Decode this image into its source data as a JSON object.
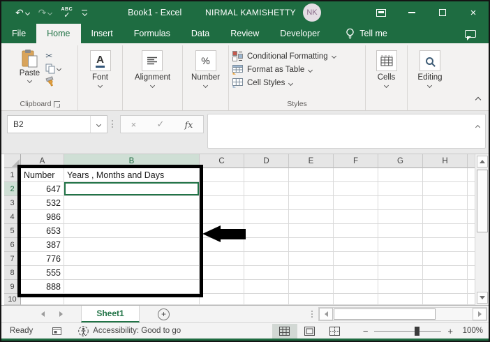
{
  "titlebar": {
    "title": "Book1 - Excel",
    "account_name": "NIRMAL KAMISHETTY",
    "avatar_initials": "NK"
  },
  "ribbon_tabs": [
    {
      "label": "File"
    },
    {
      "label": "Home"
    },
    {
      "label": "Insert"
    },
    {
      "label": "Formulas"
    },
    {
      "label": "Data"
    },
    {
      "label": "Review"
    },
    {
      "label": "Developer"
    }
  ],
  "tell_me_label": "Tell me",
  "ribbon": {
    "paste_label": "Paste",
    "clipboard_group_label": "Clipboard",
    "font_label": "Font",
    "alignment_label": "Alignment",
    "number_label": "Number",
    "conditional_formatting_label": "Conditional Formatting",
    "format_as_table_label": "Format as Table",
    "cell_styles_label": "Cell Styles",
    "styles_group_label": "Styles",
    "cells_label": "Cells",
    "editing_label": "Editing"
  },
  "formula_bar": {
    "name_box": "B2",
    "value": ""
  },
  "icons": {
    "undo_glyph": "↶",
    "redo_glyph": "↷",
    "spell_label": "ABC",
    "check_glyph": "✓",
    "cancel_glyph": "×",
    "close_glyph": "×",
    "scissors_glyph": "✂",
    "fx_label": "fx",
    "font_glyph": "A",
    "percent_glyph": "%",
    "new_sheet_glyph": "+"
  },
  "grid": {
    "columns": [
      "A",
      "B",
      "C",
      "D",
      "E",
      "F",
      "G",
      "H"
    ],
    "selected_cell": "B2",
    "rows": [
      {
        "num": "1",
        "a": "Number",
        "b": "Years , Months and Days"
      },
      {
        "num": "2",
        "a": "647",
        "b": ""
      },
      {
        "num": "3",
        "a": "532",
        "b": ""
      },
      {
        "num": "4",
        "a": "986",
        "b": ""
      },
      {
        "num": "5",
        "a": "653",
        "b": ""
      },
      {
        "num": "6",
        "a": "387",
        "b": ""
      },
      {
        "num": "7",
        "a": "776",
        "b": ""
      },
      {
        "num": "8",
        "a": "555",
        "b": ""
      },
      {
        "num": "9",
        "a": "888",
        "b": ""
      },
      {
        "num": "10",
        "a": "",
        "b": ""
      }
    ]
  },
  "sheet_tabs": {
    "active_tab": "Sheet1"
  },
  "status_bar": {
    "ready_label": "Ready",
    "accessibility_label": "Accessibility: Good to go",
    "zoom_out_glyph": "−",
    "zoom_in_glyph": "+",
    "zoom_level": "100%"
  },
  "colors": {
    "accent_green": "#217346",
    "titlebar_green": "#1E6C41",
    "avatar_bg": "#E4DDE4",
    "avatar_text": "#8A6B8A"
  }
}
